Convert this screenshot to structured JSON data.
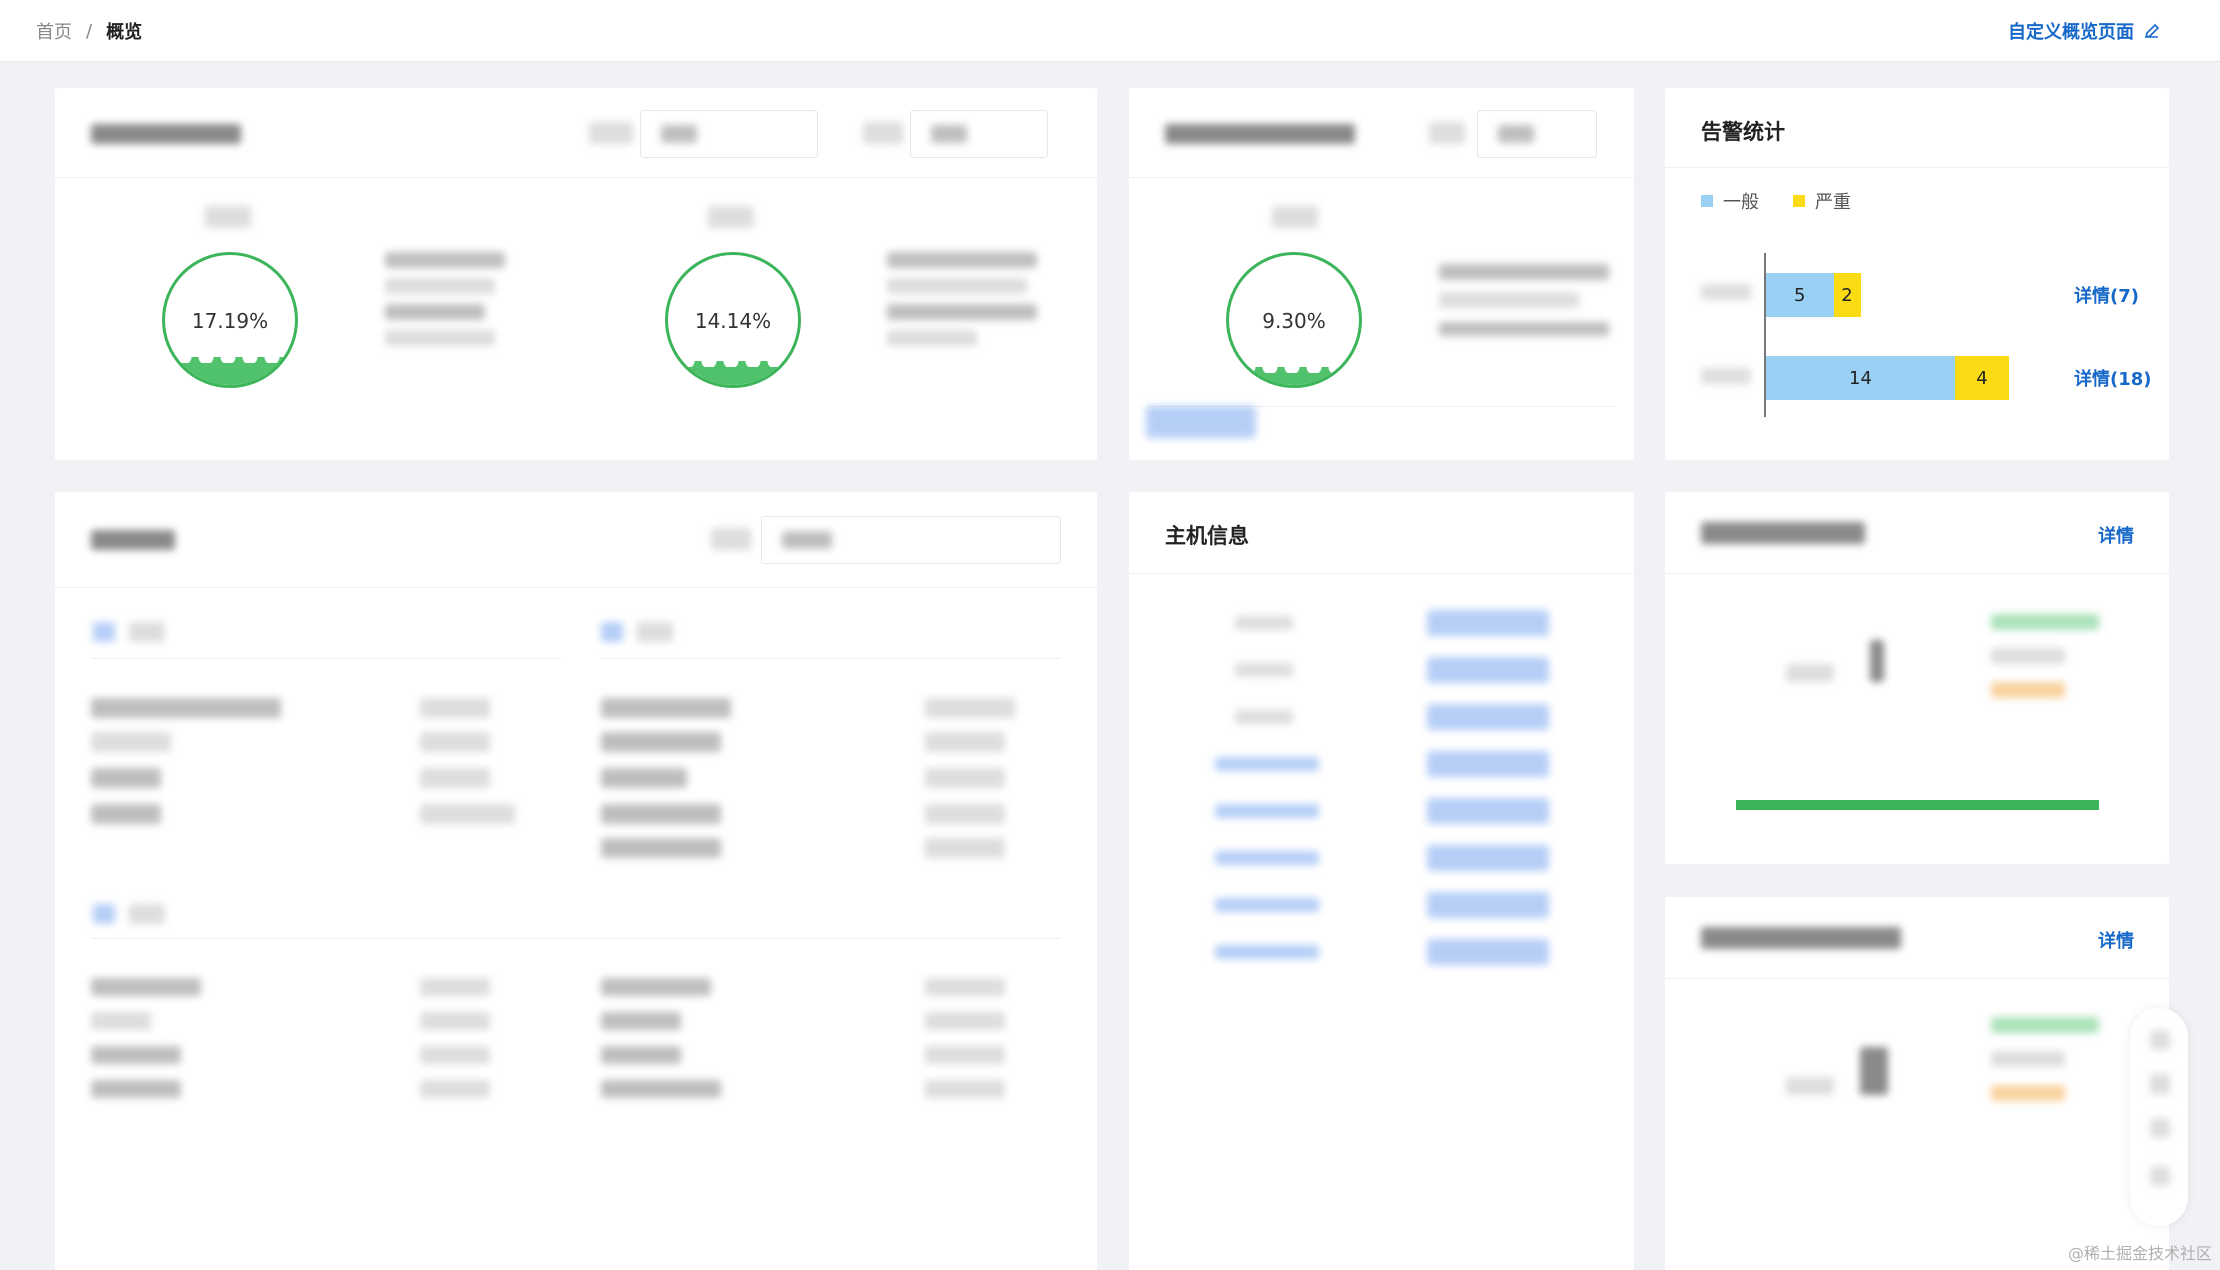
{
  "breadcrumb": {
    "home": "首页",
    "separator": "/",
    "current": "概览"
  },
  "header": {
    "customize_label": "自定义概览页面",
    "customize_icon": "edit-icon"
  },
  "resource_card": {
    "gauges": [
      {
        "percent": 0.1719,
        "label": "17.19%"
      },
      {
        "percent": 0.1414,
        "label": "14.14%"
      }
    ]
  },
  "second_card": {
    "gauges": [
      {
        "percent": 0.093,
        "label": "9.30%"
      }
    ]
  },
  "alarm_card": {
    "title": "告警统计",
    "chart_data": {
      "type": "bar",
      "orientation": "horizontal",
      "stacked": true,
      "legend_position": "top-left",
      "categories": [
        "",
        ""
      ],
      "series": [
        {
          "name": "一般",
          "values": [
            5,
            14
          ],
          "color": "#9bd0f5"
        },
        {
          "name": "严重",
          "values": [
            2,
            4
          ],
          "color": "#fadb14"
        }
      ],
      "xlim": [
        0,
        18
      ]
    },
    "details": [
      "详情(7)",
      "详情(18)"
    ]
  },
  "host_card": {
    "title": "主机信息"
  },
  "side_card_1": {
    "detail_label": "详情",
    "progress": 1.0,
    "progress_color": "#3cb55a"
  },
  "side_card_2": {
    "detail_label": "详情"
  },
  "watermark": "@稀土掘金技术社区"
}
